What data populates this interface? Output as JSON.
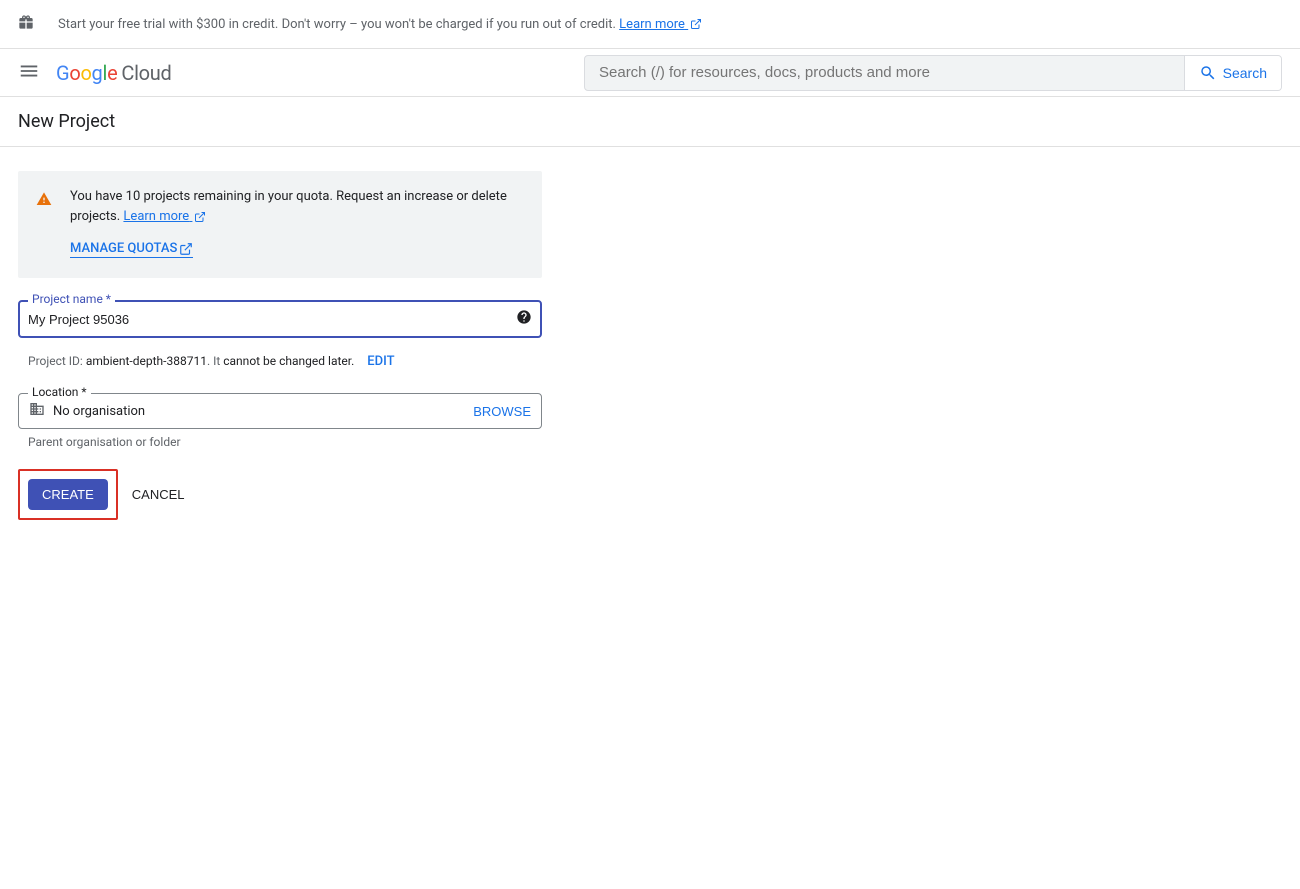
{
  "promo": {
    "text": "Start your free trial with $300 in credit. Don't worry – you won't be charged if you run out of credit. ",
    "learn_more": "Learn more"
  },
  "logo": {
    "g": "G",
    "o1": "o",
    "o2": "o",
    "g2": "g",
    "l": "l",
    "e": "e",
    "cloud": "Cloud"
  },
  "search": {
    "placeholder": "Search (/) for resources, docs, products and more",
    "button": "Search"
  },
  "page": {
    "title": "New Project"
  },
  "notice": {
    "text": "You have 10 projects remaining in your quota. Request an increase or delete projects. ",
    "learn_more": "Learn more",
    "manage_quotas": "MANAGE QUOTAS"
  },
  "project_name": {
    "label": "Project name *",
    "value": "My Project 95036"
  },
  "project_id": {
    "prefix": "Project ID: ",
    "id": "ambient-depth-388711",
    "mid": ". It ",
    "cannot": "cannot be changed later.",
    "edit": "EDIT"
  },
  "location": {
    "label": "Location *",
    "value": "No organisation",
    "browse": "BROWSE",
    "helper": "Parent organisation or folder"
  },
  "actions": {
    "create": "CREATE",
    "cancel": "CANCEL"
  }
}
